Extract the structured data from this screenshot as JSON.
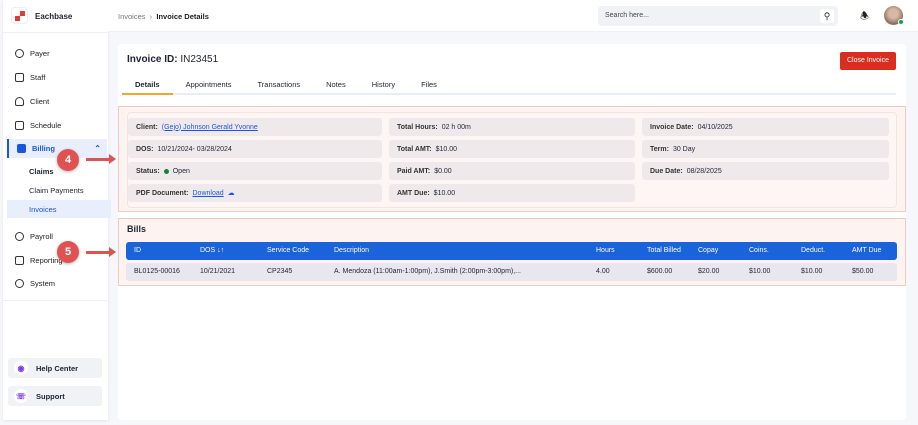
{
  "brand": "Eachbase",
  "breadcrumb": {
    "parent": "Invoices",
    "current": "Invoice Details"
  },
  "search": {
    "placeholder": "Search here..."
  },
  "sidebar": {
    "items": [
      {
        "label": "Payer"
      },
      {
        "label": "Staff"
      },
      {
        "label": "Client"
      },
      {
        "label": "Schedule"
      },
      {
        "label": "Billing"
      },
      {
        "label": "Payroll"
      },
      {
        "label": "Reporting"
      },
      {
        "label": "System"
      }
    ],
    "billing_sub": [
      {
        "label": "Claims"
      },
      {
        "label": "Claim Payments"
      },
      {
        "label": "Invoices"
      }
    ],
    "help": "Help Center",
    "support": "Support"
  },
  "invoice": {
    "label": "Invoice ID:",
    "id": "IN23451",
    "close": "Close Invoice"
  },
  "tabs": [
    "Details",
    "Appointments",
    "Transactions",
    "Notes",
    "History",
    "Files"
  ],
  "details": {
    "client": {
      "label": "Client:",
      "value": "(Gejo) Johnson Gerald Yvonne"
    },
    "dos": {
      "label": "DOS:",
      "value": "10/21/2024- 03/28/2024"
    },
    "status": {
      "label": "Status:",
      "value": "Open"
    },
    "pdf": {
      "label": "PDF Document:",
      "value": "Download"
    },
    "total_hours": {
      "label": "Total Hours:",
      "value": "02 h 00m"
    },
    "total_amt": {
      "label": "Total AMT:",
      "value": "$10.00"
    },
    "paid_amt": {
      "label": "Paid AMT:",
      "value": "$0.00"
    },
    "amt_due": {
      "label": "AMT Due:",
      "value": "$10.00"
    },
    "invoice_date": {
      "label": "Invoice Date:",
      "value": "04/10/2025"
    },
    "term": {
      "label": "Term:",
      "value": "30 Day"
    },
    "due_date": {
      "label": "Due Date:",
      "value": "08/28/2025"
    }
  },
  "bills": {
    "title": "Bills",
    "columns": [
      "ID",
      "DOS ↓↑",
      "Service Code",
      "Description",
      "Hours",
      "Total Billed",
      "Copay",
      "Coins.",
      "Deduct.",
      "AMT Due"
    ],
    "rows": [
      [
        "BL0125-00016",
        "10/21/2021",
        "CP2345",
        "A. Mendoza (11:00am-1:00pm), J.Smith (2:00pm-3:00pm),...",
        "4.00",
        "$600.00",
        "$20.00",
        "$10.00",
        "$10.00",
        "$50.00"
      ]
    ]
  },
  "annotations": [
    "4",
    "5"
  ]
}
